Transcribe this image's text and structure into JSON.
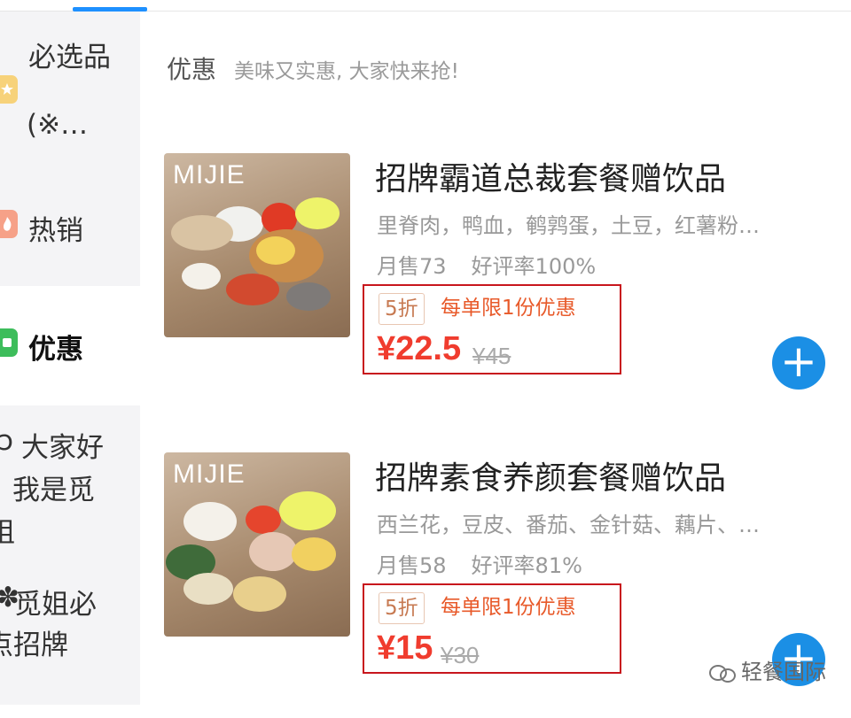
{
  "sidebar": {
    "items": [
      {
        "label_line1": "必选品",
        "label_line2": "(※…",
        "icon": "star-icon",
        "color": "#f5c23b"
      },
      {
        "label_line1": "热销",
        "icon": "flame-icon",
        "color": "#f48b6b"
      },
      {
        "label_line1": "优惠",
        "icon": "discount-icon",
        "color": "#3dbd5b",
        "active": true
      },
      {
        "label_line1": "大家好",
        "label_line2": "我是觅",
        "label_line3": "姐",
        "icon": "swirl-icon"
      },
      {
        "label_line1": "觅姐必",
        "label_line2": "点招牌",
        "icon": "flower-icon"
      }
    ]
  },
  "section": {
    "title": "优惠",
    "subtitle": "美味又实惠, 大家快来抢!"
  },
  "products": [
    {
      "image_brand": "MIJIE",
      "name": "招牌霸道总裁套餐赠饮品",
      "desc": "里脊肉，鸭血，鹌鹑蛋，土豆，红薯粉…",
      "monthly_sales": "月售73",
      "rating": "好评率100%",
      "discount": "5折",
      "promo": "每单限1份优惠",
      "price": "¥22.5",
      "original_price": "¥45"
    },
    {
      "image_brand": "MIJIE",
      "name": "招牌素食养颜套餐赠饮品",
      "desc": "西兰花，豆皮、番茄、金针菇、藕片、…",
      "monthly_sales": "月售58",
      "rating": "好评率81%",
      "discount": "5折",
      "promo": "每单限1份优惠",
      "price": "¥15",
      "original_price": "¥30"
    }
  ],
  "add_button_symbol": "+",
  "watermark": "轻餐国际",
  "colors": {
    "accent": "#1b8fe5",
    "price": "#f03c2e",
    "promo": "#e85a2a",
    "highlight_box": "#c8161d"
  }
}
